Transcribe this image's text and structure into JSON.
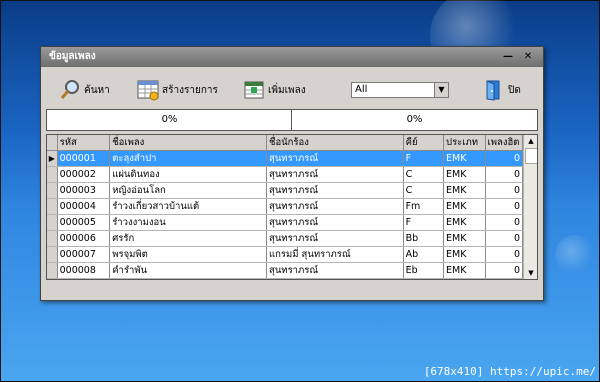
{
  "window": {
    "title": "ข้อมูลเพลง",
    "min_glyph": "—",
    "close_glyph": "✕"
  },
  "toolbar": {
    "search_label": "ค้นหา",
    "create_list_label": "สร้างรายการ",
    "add_song_label": "เพิ่มเพลง",
    "close_label": "ปิด",
    "filter_value": "All"
  },
  "progress": [
    {
      "label": "0%",
      "value": 0
    },
    {
      "label": "0%",
      "value": 0
    }
  ],
  "table": {
    "columns": [
      "รหัส",
      "ชื่อเพลง",
      "ชื่อนักร้อง",
      "คีย์",
      "ประเภท",
      "เพลงฮิต"
    ],
    "selected_index": 0,
    "rows": [
      [
        "000001",
        "ตะลุงสำปา",
        "สุนทราภรณ์",
        "F",
        "EMK",
        "0"
      ],
      [
        "000002",
        "แผ่นดินทอง",
        "สุนทราภรณ์",
        "C",
        "EMK",
        "0"
      ],
      [
        "000003",
        "หญิงอ่อนโลก",
        "สุนทราภรณ์",
        "C",
        "EMK",
        "0"
      ],
      [
        "000004",
        "รำวงเกี่ยวสาวบ้านแต้",
        "สุนทราภรณ์",
        "Fm",
        "EMK",
        "0"
      ],
      [
        "000005",
        "รำวงงามงอน",
        "สุนทราภรณ์",
        "F",
        "EMK",
        "0"
      ],
      [
        "000006",
        "ศรรัก",
        "สุนทราภรณ์",
        "Bb",
        "EMK",
        "0"
      ],
      [
        "000007",
        "พรจุมพิต",
        "แกรมมี่ สุนทราภรณ์",
        "Ab",
        "EMK",
        "0"
      ],
      [
        "000008",
        "คำรำพัน",
        "สุนทราภรณ์",
        "Eb",
        "EMK",
        "0"
      ]
    ]
  },
  "footer": {
    "text": "[678x410] https://upic.me/"
  },
  "colors": {
    "selection": "#3399ff",
    "desktop": "#1a66c4",
    "window": "#d6d3ce"
  }
}
